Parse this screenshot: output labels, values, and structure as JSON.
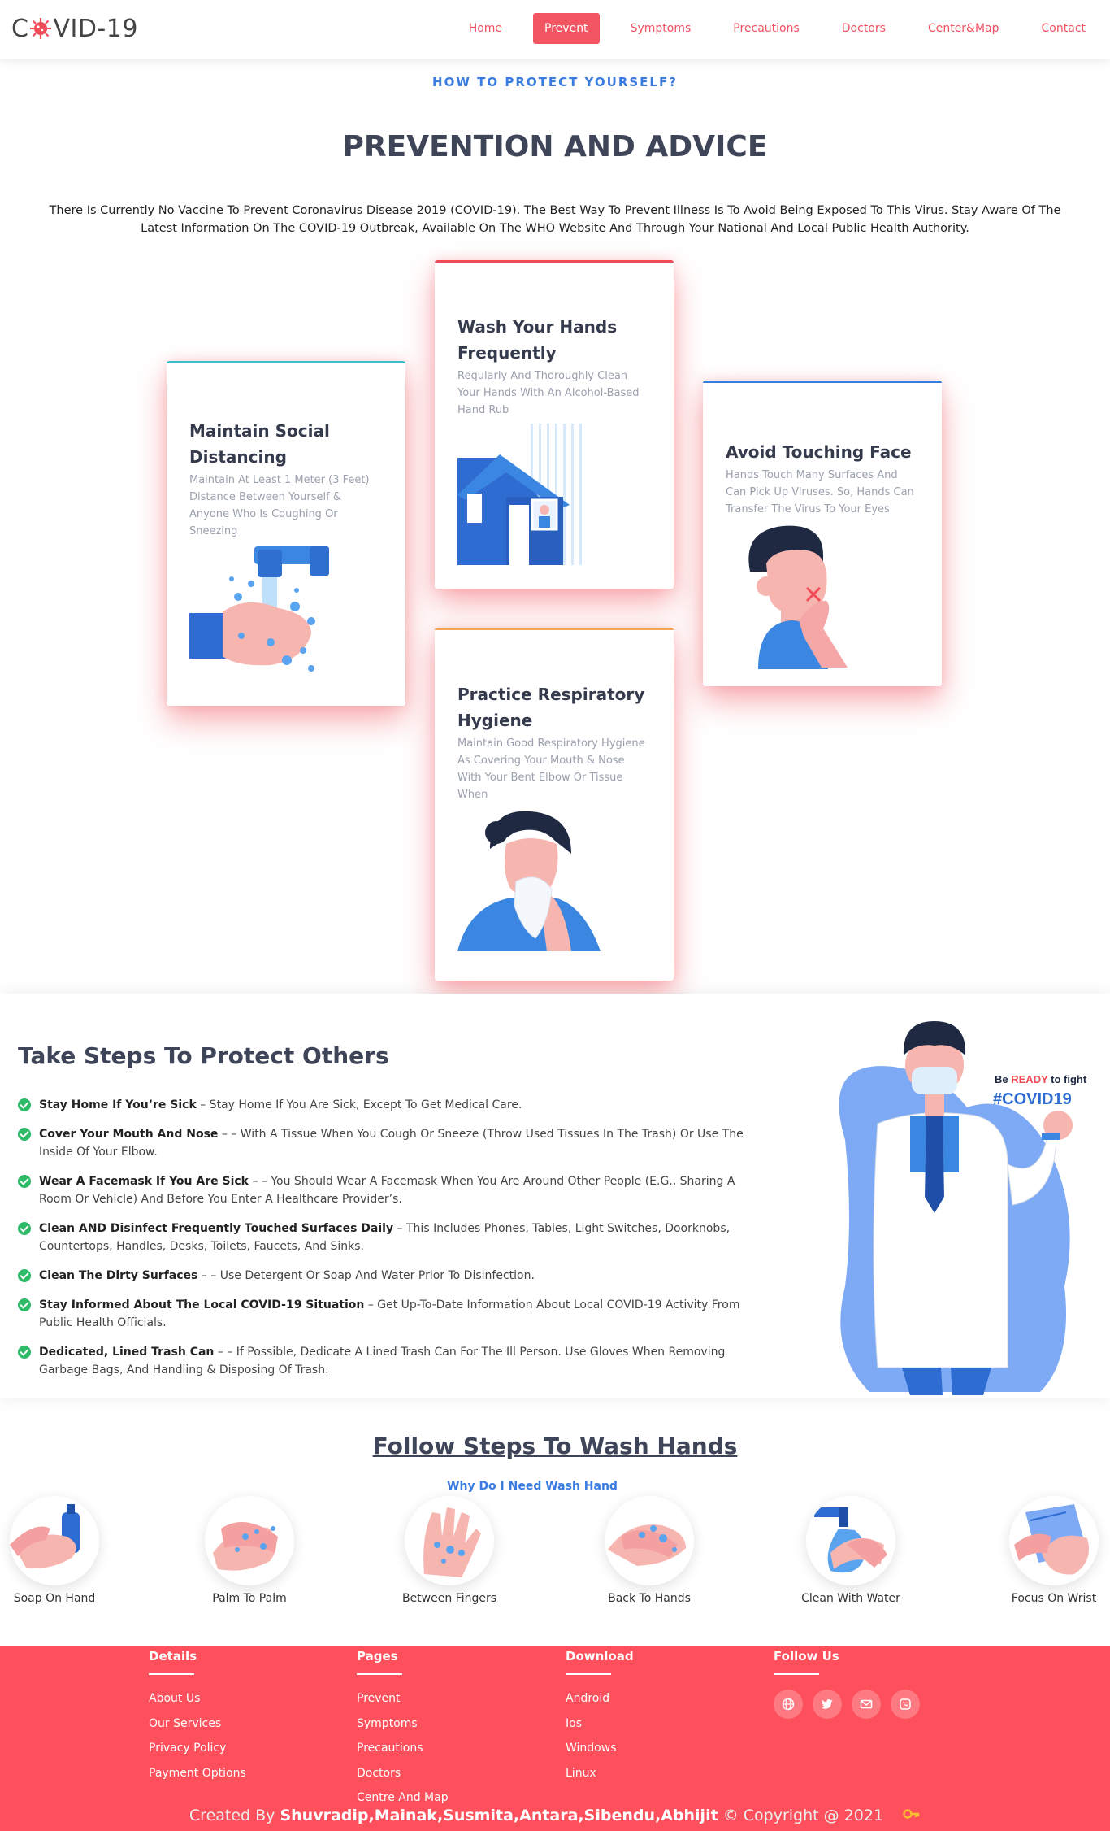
{
  "brand": {
    "pre": "C",
    "post": "VID-19"
  },
  "nav": [
    "Home",
    "Prevent",
    "Symptoms",
    "Precautions",
    "Doctors",
    "Center&Map",
    "Contact"
  ],
  "prevention": {
    "kicker": "HOW TO PROTECT YOURSELF?",
    "title": "PREVENTION AND ADVICE",
    "intro": "There Is Currently No Vaccine To Prevent Coronavirus Disease 2019 (COVID-19). The Best Way To Prevent Illness Is To Avoid Being Exposed To This Virus. Stay Aware Of The Latest Information On The COVID-19 Outbreak, Available On The WHO Website And Through Your National And Local Public Health Authority.",
    "cards": [
      {
        "title": "Maintain Social Distancing",
        "text": "Maintain At Least 1 Meter (3 Feet) Distance Between Yourself & Anyone Who Is Coughing Or Sneezing",
        "accent": "#36c1c7"
      },
      {
        "title": "Wash Your Hands Frequently",
        "text": "Regularly And Thoroughly Clean Your Hands With An Alcohol-Based Hand Rub",
        "accent": "#f04c58"
      },
      {
        "title": "Avoid Touching Face",
        "text": "Hands Touch Many Surfaces And Can Pick Up Viruses. So, Hands Can Transfer The Virus To Your Eyes",
        "accent": "#3a7be0"
      },
      {
        "title": "Practice Respiratory Hygiene",
        "text": "Maintain Good Respiratory Hygiene As Covering Your Mouth & Nose With Your Bent Elbow Or Tissue When",
        "accent": "#f5a453"
      }
    ]
  },
  "protect": {
    "title": "Take Steps To Protect Others",
    "steps": [
      {
        "bold": "Stay Home If You’re Sick",
        "text": " – Stay Home If You Are Sick, Except To Get Medical Care."
      },
      {
        "bold": "Cover Your Mouth And Nose",
        "text": " – – With A Tissue When You Cough Or Sneeze (Throw Used Tissues In The Trash) Or Use The Inside Of Your Elbow."
      },
      {
        "bold": "Wear A Facemask If You Are Sick",
        "text": " – – You Should Wear A Facemask When You Are Around Other People (E.G., Sharing A Room Or Vehicle) And Before You Enter A Healthcare Provider’s."
      },
      {
        "bold": "Clean AND Disinfect Frequently Touched Surfaces Daily",
        "text": " – This Includes Phones, Tables, Light Switches, Doorknobs, Countertops, Handles, Desks, Toilets, Faucets, And Sinks."
      },
      {
        "bold": "Clean The Dirty Surfaces",
        "text": " – – Use Detergent Or Soap And Water Prior To Disinfection."
      },
      {
        "bold": "Stay Informed About The Local COVID-19 Situation",
        "text": " – Get Up-To-Date Information About Local COVID-19 Activity From Public Health Officials."
      },
      {
        "bold": "Dedicated, Lined Trash Can",
        "text": " – – If Possible, Dedicate A Lined Trash Can For The Ill Person. Use Gloves When Removing Garbage Bags, And Handling & Disposing Of Trash."
      }
    ],
    "doctor": {
      "be": "Be",
      "ready": "READY",
      "tofight": "to fight",
      "tag": "#COVID19"
    }
  },
  "wash": {
    "title": "Follow Steps To Wash Hands",
    "subtitle": "Why Do I Need Wash Hand",
    "steps": [
      "Soap On Hand",
      "Palm To Palm",
      "Between Fingers",
      "Back To Hands",
      "Clean With Water",
      "Focus On Wrist"
    ]
  },
  "footer": {
    "details": {
      "title": "Details",
      "links": [
        "About Us",
        "Our Services",
        "Privacy Policy",
        "Payment Options"
      ]
    },
    "pages": {
      "title": "Pages",
      "links": [
        "Prevent",
        "Symptoms",
        "Precautions",
        "Doctors",
        "Centre And Map"
      ]
    },
    "download": {
      "title": "Download",
      "links": [
        "Android",
        "Ios",
        "Windows",
        "Linux"
      ]
    },
    "follow": {
      "title": "Follow Us",
      "icons": [
        "globe-icon",
        "twitter-icon",
        "mail-icon",
        "phone-icon"
      ]
    },
    "credit": {
      "pre": "Created By",
      "names": "Shuvradip,Mainak,Susmita,Antara,Sibendu,Abhijit",
      "post": "© Copyright @ 2021"
    }
  },
  "colors": {
    "accent": "#f25561",
    "footer": "#fd505c",
    "blue": "#3a7be0",
    "heading": "#3f4559"
  }
}
